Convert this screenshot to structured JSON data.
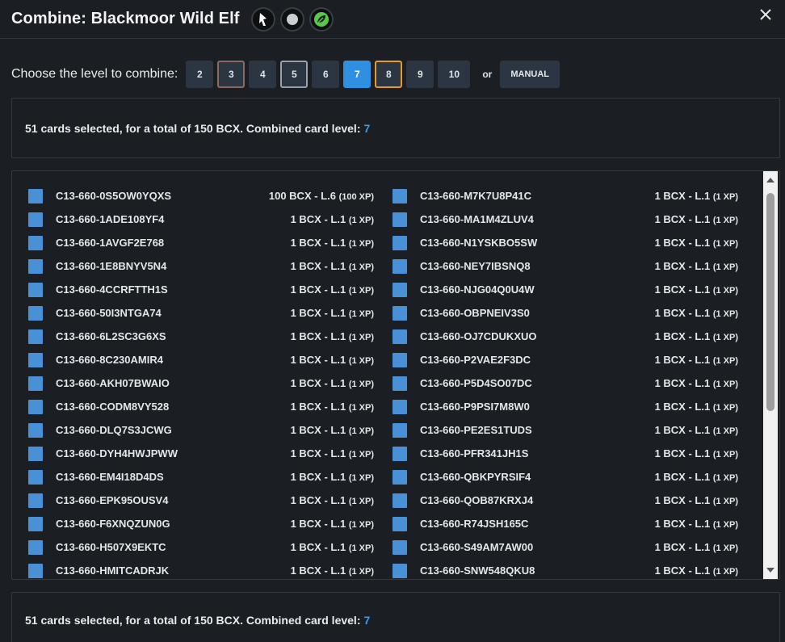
{
  "header": {
    "title": "Combine: Blackmoor Wild Elf",
    "badges": [
      {
        "icon": "ranger-icon",
        "color": "#ffffff"
      },
      {
        "icon": "neutral-circle-icon",
        "color": "#c9ced3"
      },
      {
        "icon": "leaf-icon",
        "color": "#59c74a"
      }
    ],
    "close_icon": "close-icon"
  },
  "level_selector": {
    "label": "Choose the level to combine:",
    "levels": [
      {
        "label": "2",
        "style": "none"
      },
      {
        "label": "3",
        "style": "brown"
      },
      {
        "label": "4",
        "style": "none"
      },
      {
        "label": "5",
        "style": "grey"
      },
      {
        "label": "6",
        "style": "none"
      },
      {
        "label": "7",
        "style": "blue"
      },
      {
        "label": "8",
        "style": "orange"
      },
      {
        "label": "9",
        "style": "none"
      },
      {
        "label": "10",
        "style": "none"
      }
    ],
    "or_text": "or",
    "manual_label": "MANUAL"
  },
  "summary": {
    "text": "51 cards selected, for a total of 150 BCX. Combined card level:",
    "level": "7"
  },
  "cards_left": [
    {
      "code": "C13-660-0S5OW0YQXS",
      "value": "100 BCX - L.6",
      "xp": "(100 XP)"
    },
    {
      "code": "C13-660-1ADE108YF4",
      "value": "1 BCX - L.1",
      "xp": "(1 XP)"
    },
    {
      "code": "C13-660-1AVGF2E768",
      "value": "1 BCX - L.1",
      "xp": "(1 XP)"
    },
    {
      "code": "C13-660-1E8BNYV5N4",
      "value": "1 BCX - L.1",
      "xp": "(1 XP)"
    },
    {
      "code": "C13-660-4CCRFTTH1S",
      "value": "1 BCX - L.1",
      "xp": "(1 XP)"
    },
    {
      "code": "C13-660-50I3NTGA74",
      "value": "1 BCX - L.1",
      "xp": "(1 XP)"
    },
    {
      "code": "C13-660-6L2SC3G6XS",
      "value": "1 BCX - L.1",
      "xp": "(1 XP)"
    },
    {
      "code": "C13-660-8C230AMIR4",
      "value": "1 BCX - L.1",
      "xp": "(1 XP)"
    },
    {
      "code": "C13-660-AKH07BWAIO",
      "value": "1 BCX - L.1",
      "xp": "(1 XP)"
    },
    {
      "code": "C13-660-CODM8VY528",
      "value": "1 BCX - L.1",
      "xp": "(1 XP)"
    },
    {
      "code": "C13-660-DLQ7S3JCWG",
      "value": "1 BCX - L.1",
      "xp": "(1 XP)"
    },
    {
      "code": "C13-660-DYH4HWJPWW",
      "value": "1 BCX - L.1",
      "xp": "(1 XP)"
    },
    {
      "code": "C13-660-EM4I18D4DS",
      "value": "1 BCX - L.1",
      "xp": "(1 XP)"
    },
    {
      "code": "C13-660-EPK95OUSV4",
      "value": "1 BCX - L.1",
      "xp": "(1 XP)"
    },
    {
      "code": "C13-660-F6XNQZUN0G",
      "value": "1 BCX - L.1",
      "xp": "(1 XP)"
    },
    {
      "code": "C13-660-H507X9EKTC",
      "value": "1 BCX - L.1",
      "xp": "(1 XP)"
    },
    {
      "code": "C13-660-HMITCADRJK",
      "value": "1 BCX - L.1",
      "xp": "(1 XP)"
    }
  ],
  "cards_right": [
    {
      "code": "C13-660-M7K7U8P41C",
      "value": "1 BCX - L.1",
      "xp": "(1 XP)"
    },
    {
      "code": "C13-660-MA1M4ZLUV4",
      "value": "1 BCX - L.1",
      "xp": "(1 XP)"
    },
    {
      "code": "C13-660-N1YSKBO5SW",
      "value": "1 BCX - L.1",
      "xp": "(1 XP)"
    },
    {
      "code": "C13-660-NEY7IBSNQ8",
      "value": "1 BCX - L.1",
      "xp": "(1 XP)"
    },
    {
      "code": "C13-660-NJG04Q0U4W",
      "value": "1 BCX - L.1",
      "xp": "(1 XP)"
    },
    {
      "code": "C13-660-OBPNEIV3S0",
      "value": "1 BCX - L.1",
      "xp": "(1 XP)"
    },
    {
      "code": "C13-660-OJ7CDUKXUO",
      "value": "1 BCX - L.1",
      "xp": "(1 XP)"
    },
    {
      "code": "C13-660-P2VAE2F3DC",
      "value": "1 BCX - L.1",
      "xp": "(1 XP)"
    },
    {
      "code": "C13-660-P5D4SO07DC",
      "value": "1 BCX - L.1",
      "xp": "(1 XP)"
    },
    {
      "code": "C13-660-P9PSI7M8W0",
      "value": "1 BCX - L.1",
      "xp": "(1 XP)"
    },
    {
      "code": "C13-660-PE2ES1TUDS",
      "value": "1 BCX - L.1",
      "xp": "(1 XP)"
    },
    {
      "code": "C13-660-PFR341JH1S",
      "value": "1 BCX - L.1",
      "xp": "(1 XP)"
    },
    {
      "code": "C13-660-QBKPYRSIF4",
      "value": "1 BCX - L.1",
      "xp": "(1 XP)"
    },
    {
      "code": "C13-660-QOB87KRXJ4",
      "value": "1 BCX - L.1",
      "xp": "(1 XP)"
    },
    {
      "code": "C13-660-R74JSH165C",
      "value": "1 BCX - L.1",
      "xp": "(1 XP)"
    },
    {
      "code": "C13-660-S49AM7AW00",
      "value": "1 BCX - L.1",
      "xp": "(1 XP)"
    },
    {
      "code": "C13-660-SNW548QKU8",
      "value": "1 BCX - L.1",
      "xp": "(1 XP)"
    }
  ],
  "colors": {
    "accent_blue": "#2f8fe0",
    "checkbox": "#4a90d6",
    "level_number": "#3c9cf0",
    "background": "#1b1e22"
  }
}
